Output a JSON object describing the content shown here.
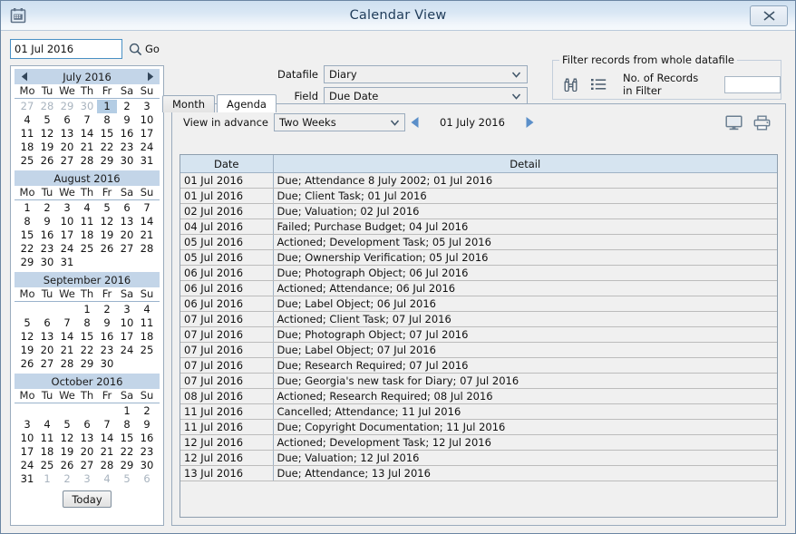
{
  "window": {
    "title": "Calendar View",
    "app_icon": "calendar-icon",
    "close_label": "Close"
  },
  "left": {
    "date_input_value": "01 Jul 2016",
    "date_input_placeholder": "",
    "go_label": "Go",
    "today_label": "Today",
    "weekday_headers": [
      "Mo",
      "Tu",
      "We",
      "Th",
      "Fr",
      "Sa",
      "Su"
    ],
    "months": [
      {
        "title": "July 2016",
        "lead_out": [
          "27",
          "28",
          "29",
          "30"
        ],
        "days": [
          "1",
          "2",
          "3",
          "4",
          "5",
          "6",
          "7",
          "8",
          "9",
          "10",
          "11",
          "12",
          "13",
          "14",
          "15",
          "16",
          "17",
          "18",
          "19",
          "20",
          "21",
          "22",
          "23",
          "24",
          "25",
          "26",
          "27",
          "28",
          "29",
          "30",
          "31"
        ],
        "trail_out": [],
        "selected": "1",
        "has_nav": true
      },
      {
        "title": "August 2016",
        "lead_out": [],
        "days": [
          "1",
          "2",
          "3",
          "4",
          "5",
          "6",
          "7",
          "8",
          "9",
          "10",
          "11",
          "12",
          "13",
          "14",
          "15",
          "16",
          "17",
          "18",
          "19",
          "20",
          "21",
          "22",
          "23",
          "24",
          "25",
          "26",
          "27",
          "28",
          "29",
          "30",
          "31"
        ],
        "trail_out": [],
        "selected": null,
        "has_nav": false
      },
      {
        "title": "September 2016",
        "lead_out": [],
        "blanks": 3,
        "days": [
          "1",
          "2",
          "3",
          "4",
          "5",
          "6",
          "7",
          "8",
          "9",
          "10",
          "11",
          "12",
          "13",
          "14",
          "15",
          "16",
          "17",
          "18",
          "19",
          "20",
          "21",
          "22",
          "23",
          "24",
          "25",
          "26",
          "27",
          "28",
          "29",
          "30"
        ],
        "trail_out": [],
        "selected": null,
        "has_nav": false
      },
      {
        "title": "October 2016",
        "lead_out": [],
        "blanks": 5,
        "days": [
          "1",
          "2",
          "3",
          "4",
          "5",
          "6",
          "7",
          "8",
          "9",
          "10",
          "11",
          "12",
          "13",
          "14",
          "15",
          "16",
          "17",
          "18",
          "19",
          "20",
          "21",
          "22",
          "23",
          "24",
          "25",
          "26",
          "27",
          "28",
          "29",
          "30",
          "31"
        ],
        "trail_out": [
          "1",
          "2",
          "3",
          "4",
          "5",
          "6"
        ],
        "selected": null,
        "has_nav": false
      }
    ]
  },
  "top": {
    "datafile_label": "Datafile",
    "datafile_value": "Diary",
    "field_label": "Field",
    "field_value": "Due Date",
    "filter_legend": "Filter records from whole datafile",
    "filter_count_label": "No. of Records in Filter",
    "filter_count_value": "",
    "binoculars_icon": "binoculars-icon",
    "list_icon": "list-icon"
  },
  "tabs": [
    {
      "label": "Month",
      "active": false
    },
    {
      "label": "Agenda",
      "active": true
    }
  ],
  "agenda": {
    "advance_label": "View in advance",
    "advance_value": "Two Weeks",
    "current_date": "01 July 2016",
    "prev_icon": "triangle-left-icon",
    "next_icon": "triangle-right-icon",
    "screen_icon": "monitor-icon",
    "print_icon": "printer-icon",
    "columns": [
      "Date",
      "Detail"
    ],
    "rows": [
      {
        "date": "01 Jul 2016",
        "detail": "Due; Attendance 8 July 2002; 01 Jul 2016"
      },
      {
        "date": "01 Jul 2016",
        "detail": "Due; Client Task; 01 Jul 2016"
      },
      {
        "date": "02 Jul 2016",
        "detail": "Due; Valuation; 02 Jul 2016"
      },
      {
        "date": "04 Jul 2016",
        "detail": "Failed; Purchase Budget; 04 Jul 2016"
      },
      {
        "date": "05 Jul 2016",
        "detail": "Actioned; Development Task; 05 Jul 2016"
      },
      {
        "date": "05 Jul 2016",
        "detail": "Due; Ownership Verification; 05 Jul 2016"
      },
      {
        "date": "06 Jul 2016",
        "detail": "Due; Photograph Object; 06 Jul 2016"
      },
      {
        "date": "06 Jul 2016",
        "detail": "Actioned; Attendance; 06 Jul 2016"
      },
      {
        "date": "06 Jul 2016",
        "detail": "Due; Label Object; 06 Jul 2016"
      },
      {
        "date": "07 Jul 2016",
        "detail": "Actioned; Client Task; 07 Jul 2016"
      },
      {
        "date": "07 Jul 2016",
        "detail": "Due; Photograph Object; 07 Jul 2016"
      },
      {
        "date": "07 Jul 2016",
        "detail": "Due; Label Object; 07 Jul 2016"
      },
      {
        "date": "07 Jul 2016",
        "detail": "Due; Research Required; 07 Jul 2016"
      },
      {
        "date": "07 Jul 2016",
        "detail": "Due; Georgia's new task for Diary; 07 Jul 2016"
      },
      {
        "date": "08 Jul 2016",
        "detail": "Actioned; Research Required; 08 Jul 2016"
      },
      {
        "date": "11 Jul 2016",
        "detail": "Cancelled; Attendance; 11 Jul 2016"
      },
      {
        "date": "11 Jul 2016",
        "detail": "Due; Copyright Documentation; 11 Jul 2016"
      },
      {
        "date": "12 Jul 2016",
        "detail": "Actioned; Development Task; 12 Jul 2016"
      },
      {
        "date": "12 Jul 2016",
        "detail": "Due; Valuation; 12 Jul 2016"
      },
      {
        "date": "13 Jul 2016",
        "detail": "Due; Attendance; 13 Jul 2016"
      }
    ]
  },
  "colors": {
    "titlebar_start": "#cfe0f0",
    "titlebar_end": "#f7fafd",
    "month_header": "#c3d5e8",
    "selected_day": "#b4cde4",
    "table_header": "#d6e4f0",
    "frame_border": "#6b86a3",
    "accent_arrow": "#5b8fc9"
  }
}
